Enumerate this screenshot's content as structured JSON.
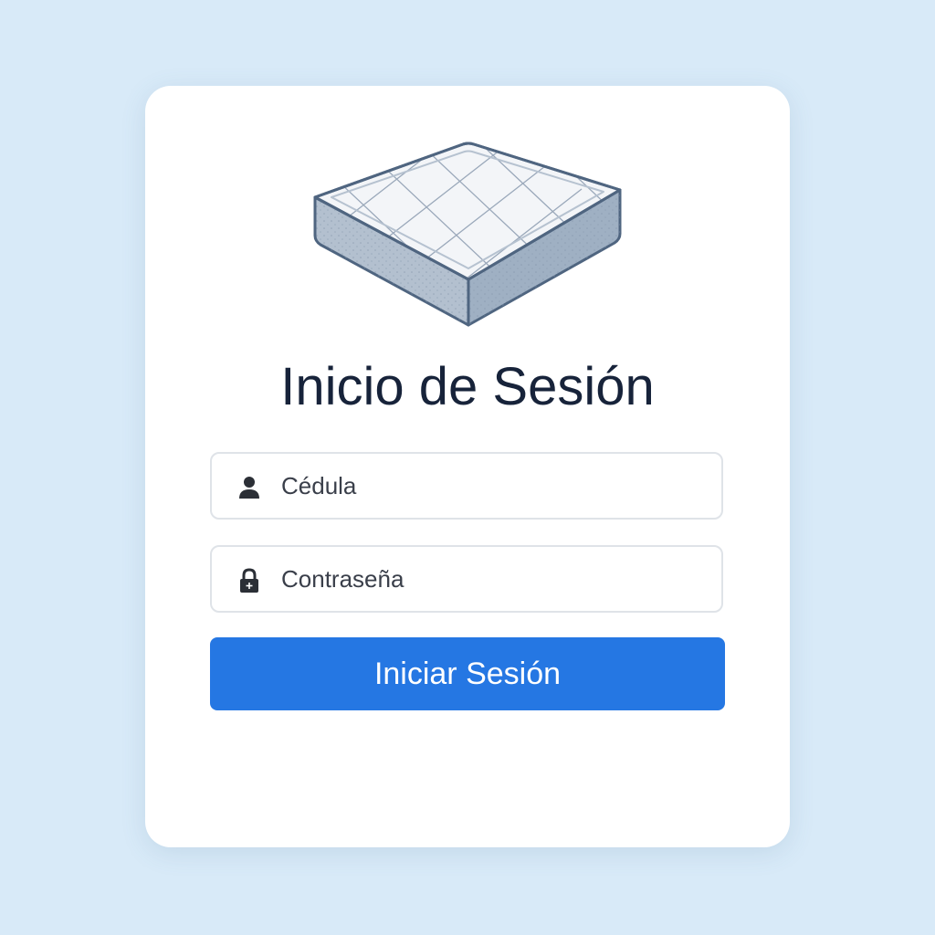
{
  "login": {
    "title": "Inicio de Sesión",
    "logo_icon": "mattress-icon",
    "username_field": {
      "icon": "user-icon",
      "placeholder": "Cédula",
      "value": ""
    },
    "password_field": {
      "icon": "lock-icon",
      "placeholder": "Contraseña",
      "value": ""
    },
    "submit_label": "Iniciar Sesión"
  },
  "colors": {
    "background": "#d8eaf8",
    "card": "#ffffff",
    "title": "#17233a",
    "button": "#2577e3",
    "mattress_top": "#f3f5f8",
    "mattress_side": "#a9b7c8",
    "mattress_outline": "#4f6580"
  }
}
